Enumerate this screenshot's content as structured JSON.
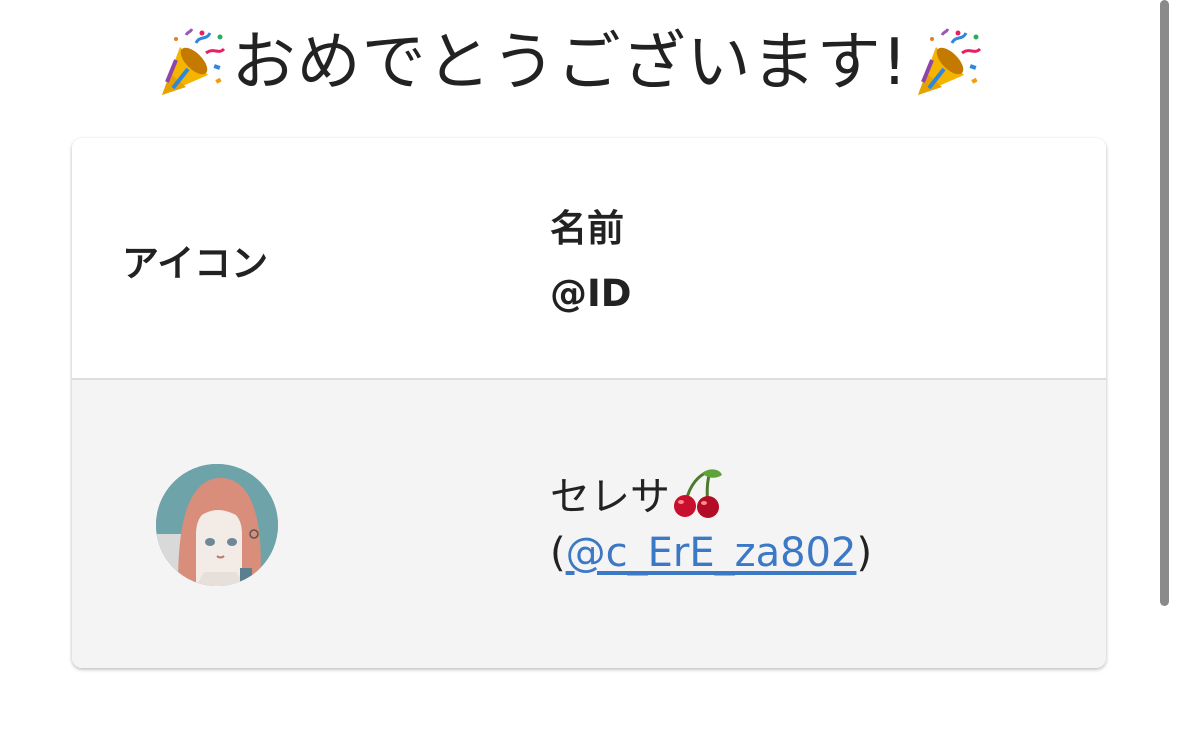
{
  "heading": {
    "title": "おめでとうございます!",
    "left_icon": "party-popper-icon",
    "right_icon": "party-popper-icon"
  },
  "table": {
    "headers": {
      "icon": "アイコン",
      "name": "名前",
      "id": "@ID"
    },
    "rows": [
      {
        "avatar": "user-avatar",
        "name": "セレサ",
        "name_emoji": "cherry-icon",
        "id_open": "(",
        "id_handle": "@c_ErE_za802",
        "id_close": ")"
      }
    ]
  },
  "colors": {
    "link": "#3b78c5",
    "row_background": "#f4f4f4",
    "text": "#222222"
  }
}
